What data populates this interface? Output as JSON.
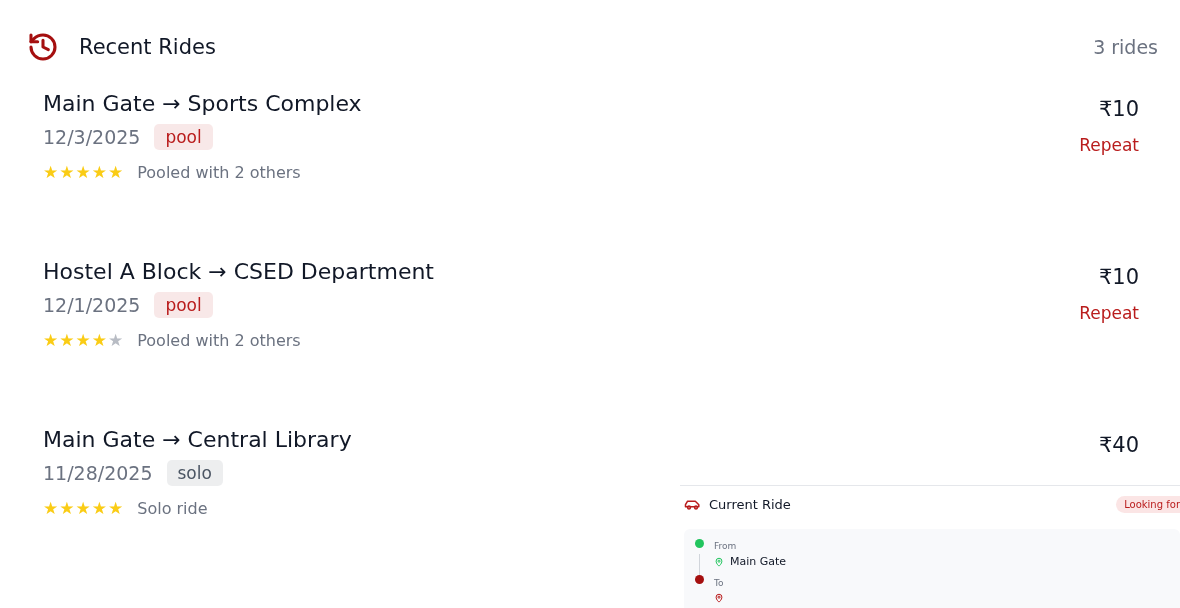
{
  "header": {
    "title": "Recent Rides",
    "count": "3 rides"
  },
  "rides": [
    {
      "route": "Main Gate → Sports Complex",
      "date": "12/3/2025",
      "tag": "pool",
      "color": "#b91c1c",
      "stars": 5,
      "note": "Pooled with 2 others",
      "price": "₹10",
      "action": "Repeat"
    },
    {
      "route": "Hostel A Block → CSED Department",
      "date": "12/1/2025",
      "tag": "pool",
      "color": "#b91c1c",
      "stars": 4,
      "note": "Pooled with 2 others",
      "price": "₹10",
      "action": "Repeat"
    },
    {
      "route": "Main Gate → Central Library",
      "date": "11/28/2025",
      "tag": "solo",
      "color": "#4b5563",
      "stars": 5,
      "note": "Solo ride",
      "price": "₹40"
    }
  ],
  "current_ride": {
    "title": "Current Ride",
    "status": "Looking for",
    "from_label": "From",
    "from": "Main Gate",
    "to_label": "To"
  }
}
